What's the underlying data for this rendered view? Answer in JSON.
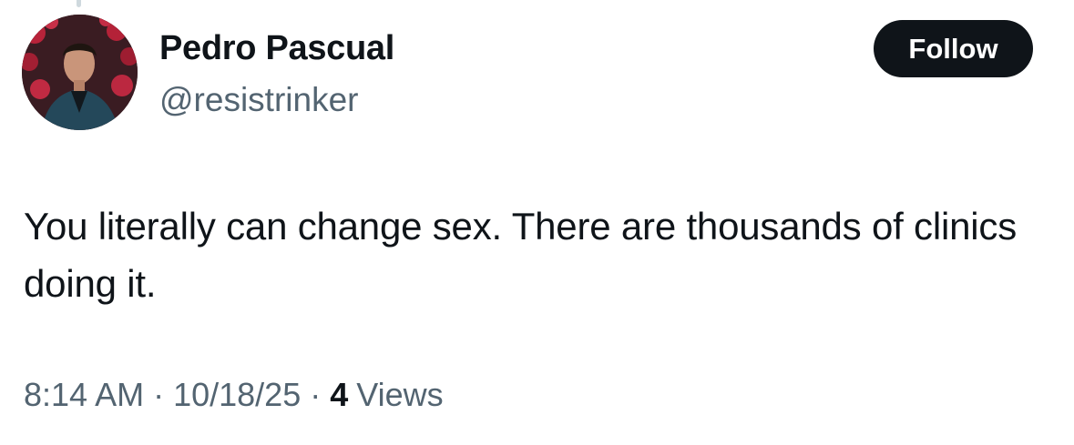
{
  "user": {
    "display_name": "Pedro Pascual",
    "handle": "@resistrinker"
  },
  "follow_button": {
    "label": "Follow"
  },
  "tweet": {
    "text": "You literally can change sex. There are thousands of clinics doing it."
  },
  "meta": {
    "time": "8:14 AM",
    "separator": "·",
    "date": "10/18/25",
    "views_count": "4",
    "views_label": "Views"
  },
  "colors": {
    "primary_text": "#0f1419",
    "secondary_text": "#536471",
    "button_bg": "#0f1419",
    "button_text": "#ffffff"
  }
}
